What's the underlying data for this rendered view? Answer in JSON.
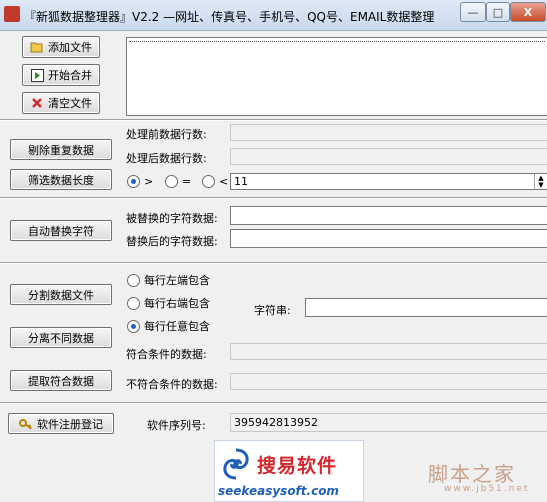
{
  "window": {
    "title": "『新狐数据整理器』V2.2 —网址、传真号、手机号、QQ号、EMAIL数据整理",
    "min_label": "—",
    "max_label": "□",
    "close_label": "X"
  },
  "buttons": {
    "add_file": "添加文件",
    "merge": "开始合并",
    "clear_file": "清空文件",
    "dedupe": "剔除重复数据",
    "filter_length": "筛选数据长度",
    "auto_replace": "自动替换字符",
    "split_file": "分割数据文件",
    "separate": "分离不同数据",
    "extract": "提取符合数据",
    "register": "软件注册登记"
  },
  "labels": {
    "before_count": "处理前数据行数:",
    "after_count": "处理后数据行数:",
    "replaced_data": "被替换的字符数据:",
    "replacement_data": "替换后的字符数据:",
    "string": "字符串:",
    "matching": "符合条件的数据:",
    "non_matching": "不符合条件的数据:",
    "serial": "软件序列号:"
  },
  "length_filter": {
    "options": [
      ">",
      "=",
      "<"
    ],
    "selected": ">",
    "value": "11"
  },
  "contains_options": {
    "options": [
      "每行左端包含",
      "每行右端包含",
      "每行任意包含"
    ],
    "selected": "每行任意包含"
  },
  "serial_value": "395942813952",
  "footer": {
    "logo_text": "搜易软件",
    "logo_url": "seekeasysoft.com",
    "watermark": "脚本之家",
    "watermark_url": "www.jb51.net"
  },
  "colors": {
    "accent_radio": "#1e5fcf",
    "logo_blue": "#1f5fb8",
    "logo_red": "#d4262c"
  }
}
